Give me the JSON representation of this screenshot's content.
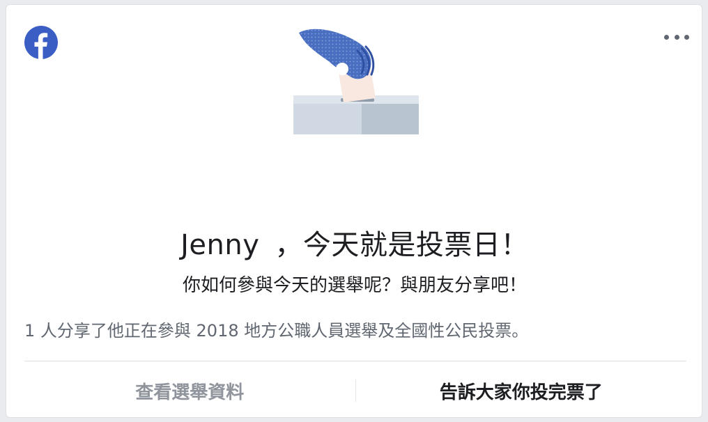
{
  "card": {
    "logo_icon": "facebook-logo-icon",
    "menu_icon": "more-horizontal-icon",
    "illustration": "ballot-box-hand-icon",
    "headline": {
      "name": "Jenny",
      "message": "，今天就是投票日！"
    },
    "subhead": "你如何參與今天的選舉呢？與朋友分享吧！",
    "share_count_text": "1 人分享了他正在參與 2018 地方公職人員選舉及全國性公民投票。",
    "actions": {
      "view_info_label": "查看選舉資料",
      "share_voted_label": "告訴大家你投完票了"
    }
  },
  "colors": {
    "brand_blue": "#1877f2",
    "hand_blue": "#4a6fc1",
    "page_bg": "#e9ebee",
    "text_primary": "#1c1e21",
    "text_secondary": "#606770",
    "text_muted": "#90949c"
  }
}
